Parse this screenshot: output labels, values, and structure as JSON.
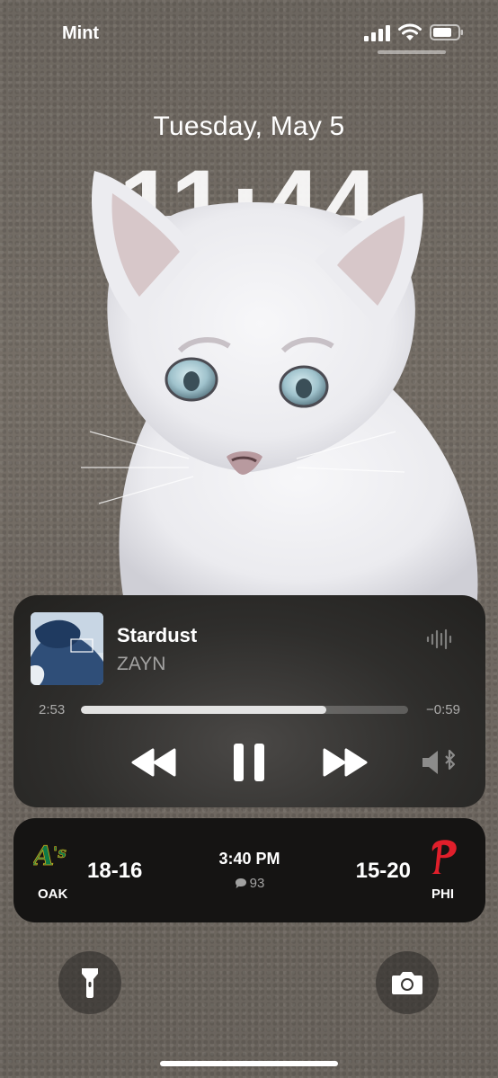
{
  "status_bar": {
    "carrier": "Mint",
    "signal_icon": "cellular-signal-icon",
    "wifi_icon": "wifi-icon",
    "battery_icon": "battery-icon"
  },
  "lock_screen": {
    "date": "Tuesday, May 5",
    "time": "11:44",
    "wallpaper": "white cat on carpet"
  },
  "now_playing": {
    "title": "Stardust",
    "artist": "ZAYN",
    "elapsed": "2:53",
    "remaining": "−0:59",
    "progress": 0.75,
    "controls": [
      "rewind-icon",
      "pause-icon",
      "fast-forward-icon"
    ],
    "audio_output_icon": "speaker-bluetooth-icon",
    "waveform_icon": "waveform-icon"
  },
  "scoreboard": {
    "away_team": "OAK",
    "away_score": "18-16",
    "game_time": "3:40 PM",
    "comment_count": "93",
    "home_team": "PHI",
    "home_score": "15-20",
    "away_logo_color": "#006b3f",
    "home_logo_color": "#e81828"
  },
  "quick_actions": {
    "left": "flashlight-icon",
    "right": "camera-icon"
  }
}
